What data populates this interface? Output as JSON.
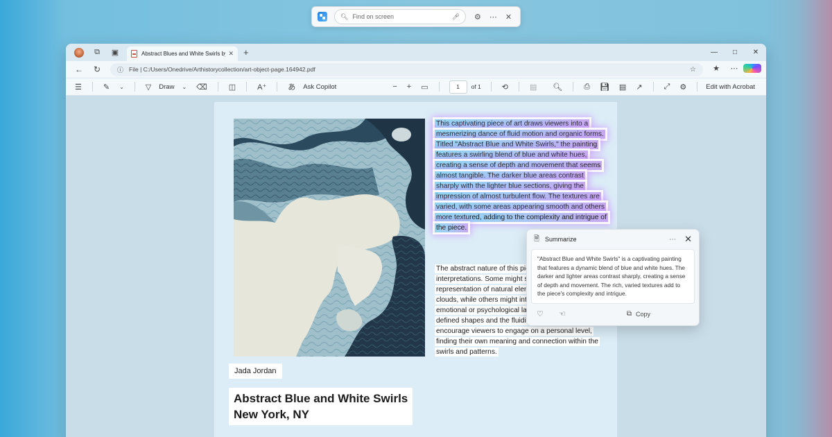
{
  "find_bar": {
    "placeholder": "Find on screen"
  },
  "tab": {
    "title": "Abstract Blues and White Swirls by J"
  },
  "address": {
    "url": "File  |  C:/Users/Onedrive/Arthistorycollection/art-object-page.164942.pdf"
  },
  "pdf_toolbar": {
    "draw_label": "Draw",
    "ask_copilot_label": "Ask Copilot",
    "page_number": "1",
    "page_total": "of 1",
    "edit_acrobat_label": "Edit with Acrobat"
  },
  "document": {
    "para1": "This captivating piece of art draws viewers into a mesmerizing dance of fluid motion and organic forms. Titled \"Abstract Blue and White Swirls,\" the painting features a swirling blend of blue and white hues, creating a sense of depth and movement that seems almost tangible. The darker blue areas contrast sharply with the lighter blue sections, giving the impression of almost turbulent flow. The textures are varied, with some areas appearing smooth and others more textured, adding to the complexity and intrigue of the piece.",
    "para2": "The abstract nature of this piece allows for multiple interpretations. Some might see it as a representation of natural elements, such as water or clouds, while others might interpret it as an emotional or psychological landscape. The lack of defined shapes and the fluidity of the forms encourage viewers to engage on a personal level, finding their own meaning and connection within the swirls and patterns.",
    "author": "Jada Jordan",
    "title_line1": "Abstract Blue and White Swirls",
    "title_line2": "New York, NY"
  },
  "summarize": {
    "title": "Summarize",
    "body": "\"Abstract Blue and White Swirls\" is a captivating painting that features a dynamic blend of blue and white hues. The darker and lighter areas contrast sharply, creating a sense of depth and movement. The rich, varied textures add to the piece's complexity and intrigue.",
    "copy_label": "Copy"
  },
  "colors": {
    "highlight_start": "#8fd6f2",
    "highlight_end": "#c7a9f0",
    "page_bg": "#dcedf7",
    "dark_swirl": "#22384a",
    "light_swirl": "#e6e6da"
  },
  "icons": [
    "search-icon",
    "mic-icon",
    "gear-icon",
    "more-icon",
    "close-icon",
    "back-icon",
    "refresh-icon",
    "star-icon",
    "pen-icon",
    "eraser-icon",
    "zoom-in-icon",
    "zoom-out-icon",
    "print-icon",
    "save-icon",
    "share-icon",
    "expand-icon",
    "settings-icon",
    "thumbs-down-icon",
    "thumbs-up-icon",
    "copy-icon",
    "copilot-icon"
  ]
}
